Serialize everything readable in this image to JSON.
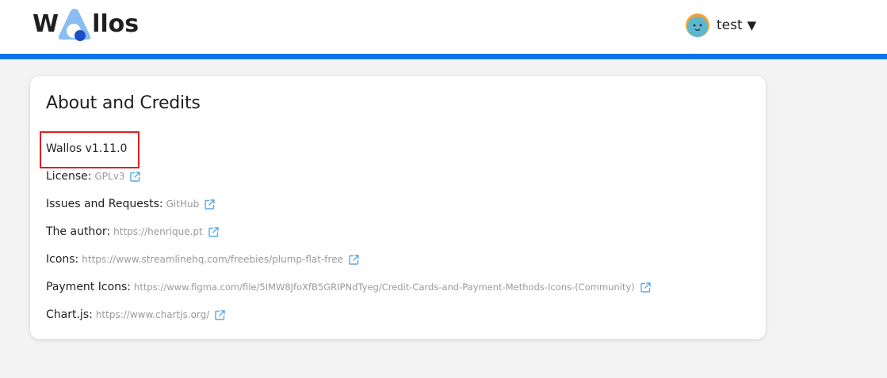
{
  "header": {
    "logo": {
      "text_prefix": "W",
      "text_suffix": "llos",
      "full_name": "Wallos"
    },
    "user": {
      "name": "test",
      "caret": "▼"
    }
  },
  "colors": {
    "accent": "#0a75e8",
    "highlight_box": "#e02020",
    "link": "#9a9a9a",
    "icon": "#5aa9e6"
  },
  "about": {
    "title": "About and Credits",
    "version": "Wallos v1.11.0",
    "rows": [
      {
        "label": "License:",
        "link": "GPLv3"
      },
      {
        "label": "Issues and Requests:",
        "link": "GitHub"
      },
      {
        "label": "The author:",
        "link": "https://henrique.pt"
      },
      {
        "label": "Icons:",
        "link": "https://www.streamlinehq.com/freebies/plump-flat-free"
      },
      {
        "label": "Payment Icons:",
        "link": "https://www.figma.com/file/5IMW8JfoXfB5GRIPNdTyeg/Credit-Cards-and-Payment-Methods-Icons-(Community)"
      },
      {
        "label": "Chart.js:",
        "link": "https://www.chartjs.org/"
      }
    ]
  },
  "icons": {
    "external_link": "external-link-icon",
    "avatar": "avatar-face",
    "logo_mark": "triangle-logo"
  }
}
